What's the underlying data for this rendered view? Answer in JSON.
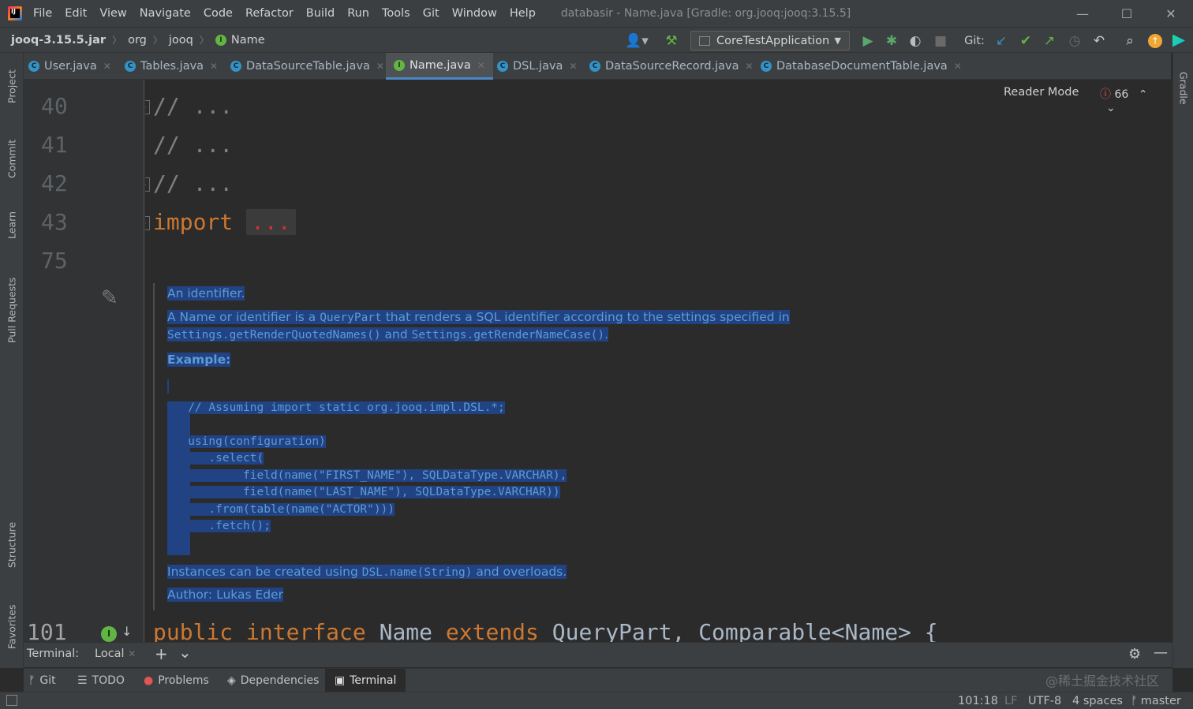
{
  "app": {
    "logo_text": "IJ",
    "menu": [
      "File",
      "Edit",
      "View",
      "Navigate",
      "Code",
      "Refactor",
      "Build",
      "Run",
      "Tools",
      "Git",
      "Window",
      "Help"
    ],
    "window_title": "databasir - Name.java [Gradle: org.jooq:jooq:3.15.5]",
    "window_controls": [
      "—",
      "☐",
      "✕"
    ]
  },
  "navbar": {
    "crumbs": [
      "jooq-3.15.5.jar",
      "org",
      "jooq",
      "Name"
    ],
    "run_config": "CoreTestApplication",
    "git_label": "Git:"
  },
  "tabs": [
    {
      "label": "User.java",
      "icon": "C"
    },
    {
      "label": "Tables.java",
      "icon": "C"
    },
    {
      "label": "DataSourceTable.java",
      "icon": "C"
    },
    {
      "label": "Name.java",
      "icon": "I"
    },
    {
      "label": "DSL.java",
      "icon": "C"
    },
    {
      "label": "DataSourceRecord.java",
      "icon": "C"
    },
    {
      "label": "DatabaseDocumentTable.java",
      "icon": "C"
    }
  ],
  "left_tools": [
    "Project",
    "Commit",
    "Learn",
    "Pull Requests",
    "Structure",
    "Favorites"
  ],
  "right_tools": [
    "Gradle"
  ],
  "editor": {
    "reader_mode": "Reader Mode",
    "error_count": "66",
    "line_numbers": [
      "40",
      "41",
      "42",
      "43",
      "75",
      "101"
    ],
    "lines": {
      "l40": "// ...",
      "l41": "// ...",
      "l42": "// ...",
      "l43_kw": "import",
      "l43_dots": "...",
      "l101_public": "public",
      "l101_interface": "interface",
      "l101_name": "Name",
      "l101_extends": "extends",
      "l101_rest": "QueryPart, Comparable<Name> {"
    },
    "doc": {
      "line1": "An identifier.",
      "line2a": "A Name or identifier is a ",
      "line2b": "QueryPart",
      "line2c": " that renders a SQL identifier according to the settings specified in",
      "line3a": "Settings.getRenderQuotedNames()",
      "line3b": " and ",
      "line3c": "Settings.getRenderNameCase()",
      "line3d": ".",
      "example": "Example:",
      "code": [
        "   // Assuming import static org.jooq.impl.DSL.*;",
        "",
        "   using(configuration)",
        "      .select(",
        "           field(name(\"FIRST_NAME\"), SQLDataType.VARCHAR),",
        "           field(name(\"LAST_NAME\"), SQLDataType.VARCHAR))",
        "      .from(table(name(\"ACTOR\")))",
        "      .fetch();"
      ],
      "instances_a": "Instances can be created using ",
      "instances_b": "DSL.name(String)",
      "instances_c": " and overloads.",
      "author_label": "Author:",
      "author_name": "Lukas Eder"
    }
  },
  "terminal": {
    "label": "Terminal:",
    "tab": "Local",
    "add": "+",
    "more": "⌄"
  },
  "bottom_tools": [
    {
      "label": "Git",
      "icon": "branch-icon"
    },
    {
      "label": "TODO",
      "icon": "list-icon"
    },
    {
      "label": "Problems",
      "icon": "error-icon"
    },
    {
      "label": "Dependencies",
      "icon": "layers-icon"
    },
    {
      "label": "Terminal",
      "icon": "terminal-icon"
    }
  ],
  "status": {
    "position": "101:18",
    "line_sep": "LF",
    "encoding": "UTF-8",
    "indent": "4 spaces",
    "branch": "master"
  },
  "watermark": "@稀土掘金技术社区",
  "colors": {
    "selection": "#214283",
    "keyword": "#cc7832",
    "comment": "#808080",
    "doc_text": "#5d9bd6",
    "interface_icon": "#62b543",
    "class_icon": "#3592c4",
    "error": "#e05555"
  }
}
